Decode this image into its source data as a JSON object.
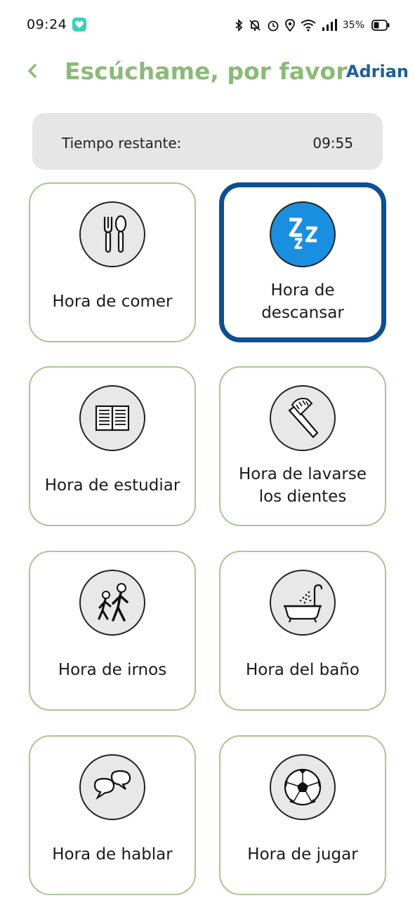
{
  "status_bar": {
    "time": "09:24",
    "battery": "35%"
  },
  "header": {
    "title": "Escúchame, por favor",
    "user": "Adrian"
  },
  "timer": {
    "label": "Tiempo restante:",
    "value": "09:55"
  },
  "cards": [
    {
      "label": "Hora de comer",
      "icon": "fork-spoon-icon",
      "selected": false
    },
    {
      "label": "Hora de descansar",
      "icon": "sleep-zzz-icon",
      "selected": true
    },
    {
      "label": "Hora de estudiar",
      "icon": "book-icon",
      "selected": false
    },
    {
      "label": "Hora de lavarse los dientes",
      "icon": "toothbrush-icon",
      "selected": false
    },
    {
      "label": "Hora de irnos",
      "icon": "walking-people-icon",
      "selected": false
    },
    {
      "label": "Hora del baño",
      "icon": "bathtub-icon",
      "selected": false
    },
    {
      "label": "Hora de hablar",
      "icon": "speech-bubbles-icon",
      "selected": false
    },
    {
      "label": "Hora de jugar",
      "icon": "soccer-ball-icon",
      "selected": false
    }
  ],
  "colors": {
    "title_green": "#8cba78",
    "accent_blue": "#1f5f9b",
    "selected_border": "#0d4f92",
    "card_border": "#a8c890"
  }
}
